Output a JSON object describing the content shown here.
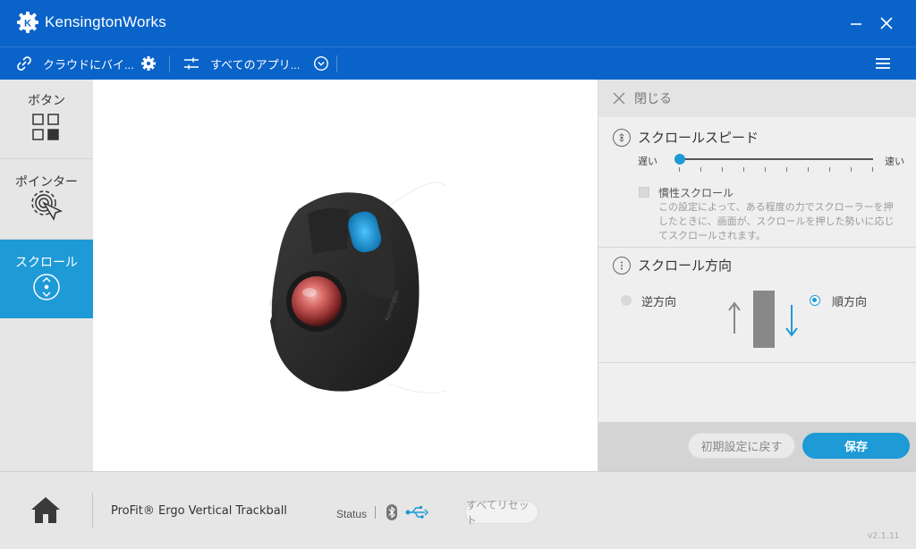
{
  "app": {
    "title": "KensingtonWorks"
  },
  "toolbar": {
    "cloud_label": "クラウドにバイ...",
    "apps_label": "すべてのアプリ..."
  },
  "sidebar": {
    "items": [
      {
        "label": "ボタン"
      },
      {
        "label": "ポインター"
      },
      {
        "label": "スクロール"
      }
    ]
  },
  "panel": {
    "close_label": "閉じる",
    "scroll_speed": {
      "title": "スクロールスピード",
      "slow_label": "遅い",
      "fast_label": "速い",
      "value": 0
    },
    "inertia": {
      "label": "慣性スクロール",
      "description": "この設定によって、ある程度の力でスクローラーを押したときに、画面が、スクロールを押した勢いに応じてスクロールされます。",
      "checked": false
    },
    "scroll_direction": {
      "title": "スクロール方向",
      "reverse_label": "逆方向",
      "forward_label": "順方向",
      "selected": "順方向"
    },
    "reset_button": "初期設定に戻す",
    "save_button": "保存"
  },
  "bottom": {
    "device_name": "ProFit® Ergo Vertical Trackball",
    "status_label": "Status",
    "reset_all_button": "すべてリセット",
    "version": "v2.1.11"
  },
  "colors": {
    "brand_blue": "#0a63c9",
    "accent_blue": "#1e9ad6"
  }
}
